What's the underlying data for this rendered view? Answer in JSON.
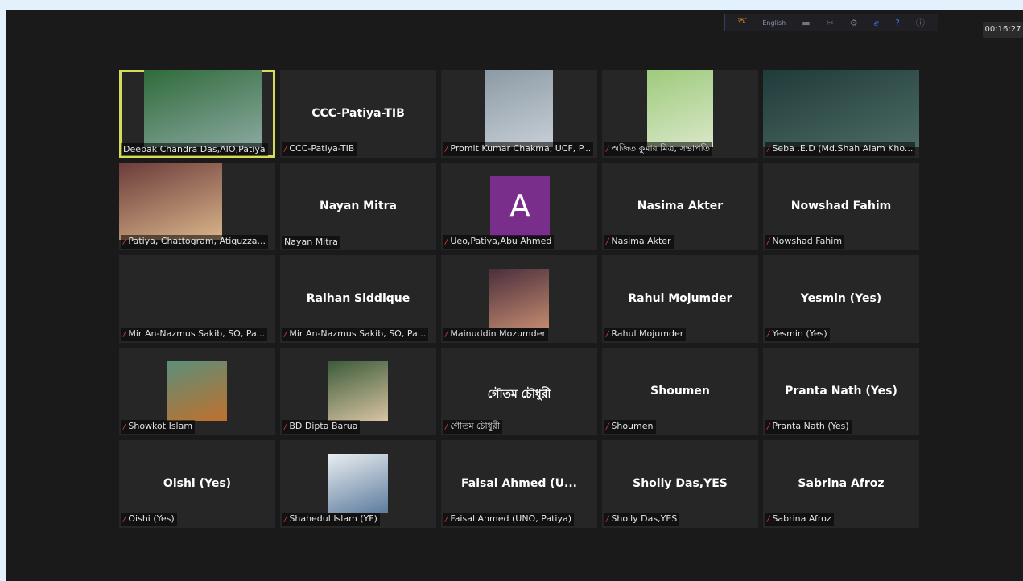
{
  "toolbar": {
    "language": "English",
    "timer": "00:16:27"
  },
  "participants": [
    {
      "label": "Deepak Chandra Das,AIO,Patiya",
      "muted": false
    },
    {
      "label": "CCC-Patiya-TIB",
      "center": "CCC-Patiya-TIB",
      "muted": true
    },
    {
      "label": "Promit Kumar Chakma, UCF, P...",
      "muted": true
    },
    {
      "label": "অজিত কুমার মিত্র, সভাপতি",
      "muted": true
    },
    {
      "label": "Seba .E.D (Md.Shah Alam Kho...",
      "muted": true
    },
    {
      "label": "Patiya, Chattogram, Atiquzza...",
      "muted": true
    },
    {
      "label": "Nayan Mitra",
      "center": "Nayan Mitra",
      "muted": false
    },
    {
      "label": "Ueo,Patiya,Abu Ahmed",
      "avatar": "A",
      "muted": true
    },
    {
      "label": "Nasima Akter",
      "center": "Nasima Akter",
      "muted": true
    },
    {
      "label": "Nowshad Fahim",
      "center": "Nowshad Fahim",
      "muted": true
    },
    {
      "label": "Mir An-Nazmus Sakib, SO, Pa...",
      "muted": true
    },
    {
      "label": "Mir An-Nazmus Sakib, SO, Pa...",
      "center": "Raihan Siddique",
      "muted": true
    },
    {
      "label": "Mainuddin Mozumder",
      "muted": true
    },
    {
      "label": "Rahul Mojumder",
      "center": "Rahul Mojumder",
      "muted": true
    },
    {
      "label": "Yesmin (Yes)",
      "center": "Yesmin (Yes)",
      "muted": true
    },
    {
      "label": "Showkot Islam",
      "muted": true
    },
    {
      "label": "BD Dipta Barua",
      "muted": true
    },
    {
      "label": "গৌতম চৌধুরী",
      "center": "গৌতম চৌধুরী",
      "muted": true
    },
    {
      "label": "Shoumen",
      "center": "Shoumen",
      "muted": true
    },
    {
      "label": "Pranta Nath (Yes)",
      "center": "Pranta Nath (Yes)",
      "muted": true
    },
    {
      "label": "Oishi (Yes)",
      "center": "Oishi (Yes)",
      "muted": true
    },
    {
      "label": "Shahedul Islam (YF)",
      "muted": true
    },
    {
      "label": "Faisal Ahmed (UNO, Patiya)",
      "center": "Faisal Ahmed (U...",
      "muted": true
    },
    {
      "label": "Shoily Das,YES",
      "center": "Shoily Das,YES",
      "muted": true
    },
    {
      "label": "Sabrina Afroz",
      "center": "Sabrina Afroz",
      "muted": true
    }
  ]
}
